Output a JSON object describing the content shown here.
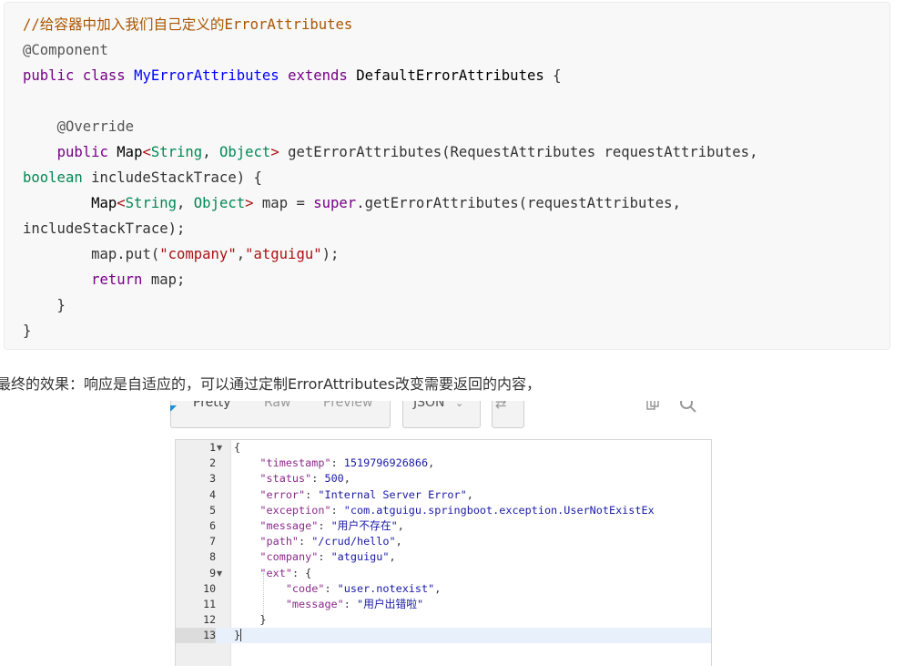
{
  "code": {
    "comment": "//给容器中加入我们自己定义的ErrorAttributes",
    "annotation_component": "@Component",
    "line3": {
      "kw1": "public",
      "kw2": "class",
      "classname": "MyErrorAttributes",
      "kw3": "extends",
      "parent": "DefaultErrorAttributes",
      "brace": "{"
    },
    "annotation_override": "@Override",
    "line6": {
      "indent": "    ",
      "kw1": "public",
      "map": "Map",
      "lt": "<",
      "t1": "String",
      "comma": ", ",
      "t2": "Object",
      "gt": ">",
      "rest": " getErrorAttributes(RequestAttributes requestAttributes,"
    },
    "line7": {
      "kw": "boolean",
      "rest": " includeStackTrace) {"
    },
    "line8": {
      "indent": "        ",
      "map": "Map",
      "lt": "<",
      "t1": "String",
      "comma": ", ",
      "t2": "Object",
      "gt": ">",
      "mid": " map = ",
      "super": "super",
      "rest": ".getErrorAttributes(requestAttributes,"
    },
    "line9": "includeStackTrace);",
    "line10": {
      "indent": "        ",
      "pre": "map.put(",
      "s1": "\"company\"",
      "c": ",",
      "s2": "\"atguigu\"",
      "post": ");"
    },
    "line11": {
      "indent": "        ",
      "kw": "return",
      "rest": " map;"
    },
    "line12": "    }",
    "line13": "}"
  },
  "caption": "最终的效果：响应是自适应的，可以通过定制ErrorAttributes改变需要返回的内容，",
  "response_viewer": {
    "tabs": [
      "Pretty",
      "Raw",
      "Preview"
    ],
    "active_tab": "Pretty",
    "format": "JSON",
    "accent_color": "#1a8fd8",
    "line_numbers": [
      "1",
      "2",
      "3",
      "4",
      "5",
      "6",
      "7",
      "8",
      "9",
      "10",
      "11",
      "12",
      "13"
    ],
    "json": {
      "timestamp": "1519796926866",
      "status": "500",
      "error": "\"Internal Server Error\"",
      "exception": "\"com.atguigu.springboot.exception.UserNotExistEx",
      "message": "\"用户不存在\"",
      "path": "\"/crud/hello\"",
      "company": "\"atguigu\"",
      "ext_code": "\"user.notexist\"",
      "ext_message": "\"用户出错啦\""
    },
    "keys": {
      "timestamp": "\"timestamp\"",
      "status": "\"status\"",
      "error": "\"error\"",
      "exception": "\"exception\"",
      "message": "\"message\"",
      "path": "\"path\"",
      "company": "\"company\"",
      "ext": "\"ext\"",
      "code": "\"code\""
    }
  }
}
